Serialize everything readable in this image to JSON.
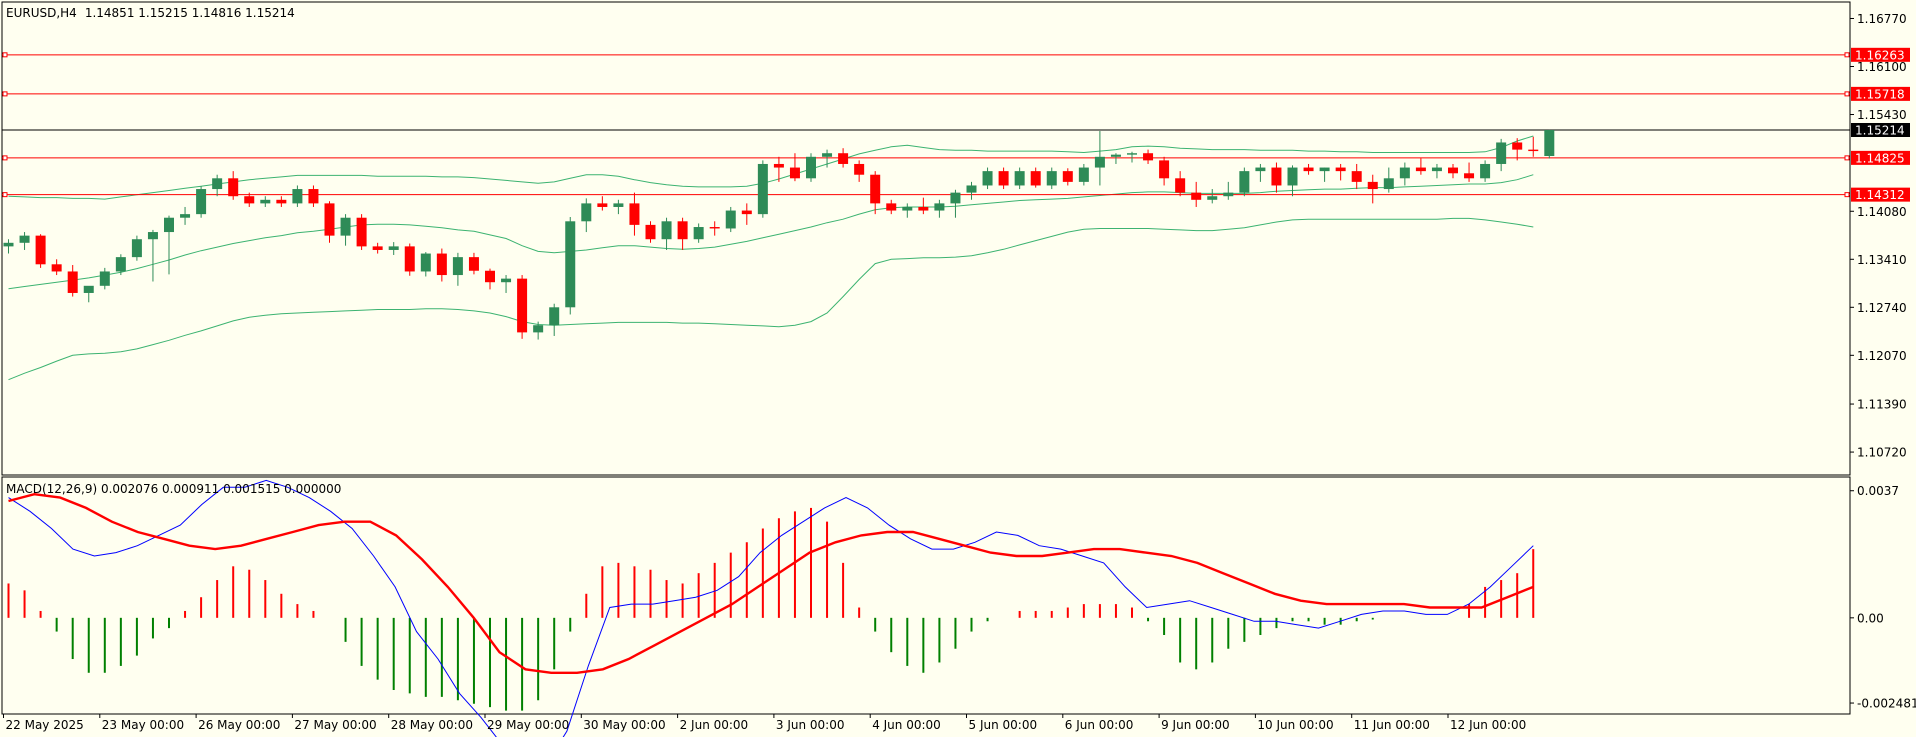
{
  "header": {
    "symbol": "EURUSD,H4",
    "ohlc": "1.14851 1.15215 1.14816 1.15214"
  },
  "macd_header": "MACD(12,26,9) 0.002076 0.000911 0.001515 0.000000",
  "colors": {
    "background": "#fffff0",
    "bull_candle": "#2e8b57",
    "bear_candle": "#ff0000",
    "bollinger": "#3cb371",
    "level_line": "#ff0000",
    "current_price": "#000000",
    "macd_line": "#0000ff",
    "signal_line": "#ff0000",
    "hist_positive": "#ff0000",
    "hist_negative": "#008000"
  },
  "chart_data": [
    {
      "type": "candlestick",
      "timeframe": "H4",
      "symbol": "EURUSD",
      "ylim": [
        1.104,
        1.17
      ],
      "yticks": [
        "1.16770",
        "1.16100",
        "1.15430",
        "1.14080",
        "1.13410",
        "1.12740",
        "1.12070",
        "1.11390",
        "1.10720"
      ],
      "xticks": [
        "22 May 2025",
        "23 May 00:00",
        "26 May 00:00",
        "27 May 00:00",
        "28 May 00:00",
        "29 May 00:00",
        "30 May 00:00",
        "2 Jun 00:00",
        "3 Jun 00:00",
        "4 Jun 00:00",
        "5 Jun 00:00",
        "6 Jun 00:00",
        "9 Jun 00:00",
        "10 Jun 00:00",
        "11 Jun 00:00",
        "12 Jun 00:00"
      ],
      "candles_per_day": 6,
      "candles": [
        [
          1.1359,
          1.1369,
          1.1349,
          1.1364
        ],
        [
          1.1364,
          1.1379,
          1.1354,
          1.1374
        ],
        [
          1.1374,
          1.1376,
          1.1329,
          1.1334
        ],
        [
          1.1334,
          1.1341,
          1.1319,
          1.1324
        ],
        [
          1.1324,
          1.1333,
          1.1289,
          1.1294
        ],
        [
          1.1294,
          1.1297,
          1.1281,
          1.1304
        ],
        [
          1.1304,
          1.1329,
          1.1299,
          1.1324
        ],
        [
          1.1324,
          1.1348,
          1.1319,
          1.1344
        ],
        [
          1.1344,
          1.1374,
          1.1339,
          1.1369
        ],
        [
          1.1369,
          1.1382,
          1.131,
          1.1379
        ],
        [
          1.1379,
          1.1402,
          1.132,
          1.1399
        ],
        [
          1.1399,
          1.1414,
          1.1389,
          1.1404
        ],
        [
          1.1404,
          1.1443,
          1.1399,
          1.1439
        ],
        [
          1.1439,
          1.1459,
          1.1429,
          1.1454
        ],
        [
          1.1454,
          1.1464,
          1.1424,
          1.1429
        ],
        [
          1.1429,
          1.1434,
          1.1414,
          1.1419
        ],
        [
          1.1419,
          1.1429,
          1.1414,
          1.1424
        ],
        [
          1.1424,
          1.1429,
          1.1414,
          1.1419
        ],
        [
          1.1419,
          1.1444,
          1.1414,
          1.1439
        ],
        [
          1.1439,
          1.1444,
          1.1414,
          1.1419
        ],
        [
          1.1419,
          1.1422,
          1.1364,
          1.1374
        ],
        [
          1.1374,
          1.1404,
          1.136,
          1.1399
        ],
        [
          1.1399,
          1.1404,
          1.1354,
          1.1359
        ],
        [
          1.1359,
          1.1364,
          1.1349,
          1.1354
        ],
        [
          1.1354,
          1.1365,
          1.1347,
          1.1359
        ],
        [
          1.1359,
          1.1363,
          1.1318,
          1.1324
        ],
        [
          1.1324,
          1.1351,
          1.1317,
          1.1349
        ],
        [
          1.1349,
          1.1356,
          1.131,
          1.1319
        ],
        [
          1.1319,
          1.135,
          1.1304,
          1.1344
        ],
        [
          1.1344,
          1.135,
          1.132,
          1.1325
        ],
        [
          1.1325,
          1.1328,
          1.1299,
          1.1309
        ],
        [
          1.1309,
          1.1319,
          1.1294,
          1.1314
        ],
        [
          1.1314,
          1.1319,
          1.123,
          1.1239
        ],
        [
          1.1239,
          1.1254,
          1.1229,
          1.1249
        ],
        [
          1.1249,
          1.1279,
          1.1234,
          1.1274
        ],
        [
          1.1274,
          1.14,
          1.1264,
          1.1394
        ],
        [
          1.1394,
          1.1426,
          1.1379,
          1.1419
        ],
        [
          1.1419,
          1.1429,
          1.1409,
          1.1414
        ],
        [
          1.1414,
          1.1424,
          1.1404,
          1.1419
        ],
        [
          1.1419,
          1.1434,
          1.1374,
          1.1389
        ],
        [
          1.1389,
          1.1394,
          1.1364,
          1.1369
        ],
        [
          1.1369,
          1.1399,
          1.1354,
          1.1394
        ],
        [
          1.1394,
          1.1399,
          1.1354,
          1.1369
        ],
        [
          1.1369,
          1.1391,
          1.1364,
          1.1386
        ],
        [
          1.1386,
          1.1394,
          1.1374,
          1.1384
        ],
        [
          1.1384,
          1.1414,
          1.1379,
          1.1409
        ],
        [
          1.1409,
          1.1419,
          1.1389,
          1.1404
        ],
        [
          1.1404,
          1.1479,
          1.1399,
          1.1474
        ],
        [
          1.1474,
          1.1484,
          1.1449,
          1.1469
        ],
        [
          1.1469,
          1.1489,
          1.145,
          1.1454
        ],
        [
          1.1454,
          1.1489,
          1.1449,
          1.1484
        ],
        [
          1.1484,
          1.1494,
          1.1469,
          1.1489
        ],
        [
          1.1489,
          1.1496,
          1.1469,
          1.1474
        ],
        [
          1.1474,
          1.1479,
          1.1449,
          1.1459
        ],
        [
          1.1459,
          1.1464,
          1.1404,
          1.1419
        ],
        [
          1.1419,
          1.1424,
          1.1404,
          1.1409
        ],
        [
          1.1409,
          1.1419,
          1.1399,
          1.1414
        ],
        [
          1.1414,
          1.1427,
          1.1404,
          1.1409
        ],
        [
          1.1409,
          1.1424,
          1.1399,
          1.1419
        ],
        [
          1.1419,
          1.1438,
          1.1399,
          1.1434
        ],
        [
          1.1434,
          1.1449,
          1.1424,
          1.1444
        ],
        [
          1.1444,
          1.1469,
          1.1439,
          1.1464
        ],
        [
          1.1464,
          1.1469,
          1.1439,
          1.1444
        ],
        [
          1.1444,
          1.1469,
          1.1439,
          1.1464
        ],
        [
          1.1464,
          1.1469,
          1.1441,
          1.1444
        ],
        [
          1.1444,
          1.1469,
          1.1439,
          1.1464
        ],
        [
          1.1464,
          1.1468,
          1.1444,
          1.1449
        ],
        [
          1.1449,
          1.1474,
          1.1444,
          1.1469
        ],
        [
          1.1469,
          1.152,
          1.1444,
          1.1484
        ],
        [
          1.1484,
          1.1489,
          1.1474,
          1.1487
        ],
        [
          1.1487,
          1.1491,
          1.1476,
          1.1489
        ],
        [
          1.1489,
          1.1494,
          1.1474,
          1.1479
        ],
        [
          1.1479,
          1.1484,
          1.1444,
          1.1454
        ],
        [
          1.1454,
          1.1464,
          1.1429,
          1.1434
        ],
        [
          1.1434,
          1.1449,
          1.1414,
          1.1424
        ],
        [
          1.1424,
          1.1439,
          1.1419,
          1.1429
        ],
        [
          1.1429,
          1.1449,
          1.1424,
          1.1434
        ],
        [
          1.1434,
          1.1469,
          1.1429,
          1.1464
        ],
        [
          1.1464,
          1.1474,
          1.1449,
          1.1469
        ],
        [
          1.1469,
          1.1476,
          1.1434,
          1.1444
        ],
        [
          1.1444,
          1.1472,
          1.1429,
          1.1469
        ],
        [
          1.1469,
          1.1474,
          1.1459,
          1.1464
        ],
        [
          1.1464,
          1.1469,
          1.1449,
          1.1469
        ],
        [
          1.1469,
          1.1474,
          1.1451,
          1.1464
        ],
        [
          1.1464,
          1.1474,
          1.1439,
          1.1449
        ],
        [
          1.1449,
          1.1459,
          1.1419,
          1.1439
        ],
        [
          1.1439,
          1.1469,
          1.1434,
          1.1454
        ],
        [
          1.1454,
          1.1476,
          1.1444,
          1.1469
        ],
        [
          1.1469,
          1.1482,
          1.1459,
          1.1464
        ],
        [
          1.1464,
          1.1474,
          1.1454,
          1.1469
        ],
        [
          1.1469,
          1.1474,
          1.1454,
          1.1461
        ],
        [
          1.1461,
          1.1476,
          1.1449,
          1.1454
        ],
        [
          1.1454,
          1.1479,
          1.1449,
          1.1474
        ],
        [
          1.1474,
          1.1509,
          1.1464,
          1.1504
        ],
        [
          1.1504,
          1.151,
          1.1479,
          1.1494
        ],
        [
          1.1494,
          1.1512,
          1.1484,
          1.1492
        ],
        [
          1.14851,
          1.15215,
          1.14816,
          1.15214
        ]
      ],
      "bollinger_upper": [
        1.1429,
        1.1428,
        1.1427,
        1.1427,
        1.1426,
        1.1426,
        1.1425,
        1.1428,
        1.1431,
        1.1434,
        1.1437,
        1.144,
        1.1443,
        1.1446,
        1.1449,
        1.1452,
        1.1454,
        1.1456,
        1.1458,
        1.1458,
        1.1458,
        1.1458,
        1.1458,
        1.1457,
        1.1457,
        1.1457,
        1.1457,
        1.1456,
        1.1456,
        1.1455,
        1.1453,
        1.1451,
        1.1449,
        1.1447,
        1.1449,
        1.1454,
        1.1459,
        1.1459,
        1.1457,
        1.1452,
        1.1448,
        1.1445,
        1.1443,
        1.1442,
        1.1442,
        1.1442,
        1.1443,
        1.1447,
        1.1453,
        1.146,
        1.1467,
        1.1474,
        1.1481,
        1.1488,
        1.1493,
        1.1498,
        1.15,
        1.1497,
        1.1494,
        1.1493,
        1.1493,
        1.1492,
        1.1492,
        1.1492,
        1.1492,
        1.1492,
        1.1491,
        1.149,
        1.1492,
        1.1494,
        1.1498,
        1.1499,
        1.1498,
        1.1496,
        1.1495,
        1.1494,
        1.1494,
        1.1494,
        1.1493,
        1.1493,
        1.1493,
        1.1492,
        1.1492,
        1.1491,
        1.1491,
        1.149,
        1.149,
        1.149,
        1.149,
        1.149,
        1.149,
        1.149,
        1.1491,
        1.1497,
        1.1506,
        1.1513
      ],
      "bollinger_middle": [
        1.13,
        1.1303,
        1.1306,
        1.1309,
        1.1312,
        1.1315,
        1.1319,
        1.1323,
        1.1328,
        1.1334,
        1.134,
        1.1347,
        1.1353,
        1.1358,
        1.1363,
        1.1367,
        1.1371,
        1.1374,
        1.1378,
        1.138,
        1.1383,
        1.1386,
        1.1389,
        1.139,
        1.139,
        1.1389,
        1.1387,
        1.1385,
        1.1382,
        1.138,
        1.1375,
        1.137,
        1.136,
        1.1352,
        1.135,
        1.1352,
        1.1354,
        1.1357,
        1.136,
        1.136,
        1.1358,
        1.1356,
        1.1355,
        1.1356,
        1.1358,
        1.1362,
        1.1366,
        1.1371,
        1.1376,
        1.1381,
        1.1386,
        1.1392,
        1.1397,
        1.1404,
        1.141,
        1.1413,
        1.1414,
        1.1414,
        1.1414,
        1.1415,
        1.1417,
        1.1419,
        1.1421,
        1.1423,
        1.1424,
        1.1425,
        1.1426,
        1.1428,
        1.143,
        1.1432,
        1.1434,
        1.1435,
        1.1435,
        1.1434,
        1.1433,
        1.1433,
        1.1433,
        1.1433,
        1.1434,
        1.1436,
        1.1437,
        1.1438,
        1.1439,
        1.1439,
        1.144,
        1.1441,
        1.1441,
        1.1442,
        1.1443,
        1.1444,
        1.1445,
        1.1446,
        1.1446,
        1.1448,
        1.1452,
        1.1459
      ],
      "bollinger_lower": [
        1.1173,
        1.1182,
        1.119,
        1.1199,
        1.1207,
        1.1209,
        1.121,
        1.1212,
        1.1216,
        1.1222,
        1.1228,
        1.1235,
        1.1241,
        1.1248,
        1.1255,
        1.126,
        1.1263,
        1.1265,
        1.1266,
        1.1267,
        1.1268,
        1.1269,
        1.127,
        1.1271,
        1.1271,
        1.1271,
        1.1272,
        1.1272,
        1.1271,
        1.1269,
        1.1266,
        1.1261,
        1.1254,
        1.125,
        1.1249,
        1.125,
        1.1251,
        1.1252,
        1.1253,
        1.1253,
        1.1253,
        1.1253,
        1.1252,
        1.1252,
        1.1251,
        1.125,
        1.1249,
        1.1248,
        1.1247,
        1.1249,
        1.1254,
        1.1266,
        1.1289,
        1.1313,
        1.1335,
        1.1341,
        1.1342,
        1.1343,
        1.1343,
        1.1344,
        1.1346,
        1.135,
        1.1355,
        1.1361,
        1.1367,
        1.1373,
        1.1379,
        1.1383,
        1.1384,
        1.1384,
        1.1384,
        1.1384,
        1.1383,
        1.1382,
        1.1381,
        1.1381,
        1.1383,
        1.1385,
        1.1389,
        1.1393,
        1.1396,
        1.1397,
        1.1397,
        1.1397,
        1.1397,
        1.1397,
        1.1397,
        1.1397,
        1.1397,
        1.1397,
        1.1398,
        1.1398,
        1.1396,
        1.1393,
        1.139,
        1.1386
      ],
      "price_levels": [
        {
          "label": "1.16263",
          "value": 1.16263
        },
        {
          "label": "1.15718",
          "value": 1.15718
        },
        {
          "label": "1.14825",
          "value": 1.14825
        },
        {
          "label": "1.14312",
          "value": 1.14312
        }
      ],
      "current_price": {
        "label": "1.15214",
        "value": 1.15214
      }
    },
    {
      "type": "macd",
      "params": "12,26,9",
      "ylim": [
        -0.0028,
        0.0041
      ],
      "yticks": [
        {
          "label": "0.0037",
          "value": 0.0037
        },
        {
          "label": "0.00",
          "value": 0
        },
        {
          "label": "-0.002481",
          "value": -0.002481
        }
      ],
      "histogram": [
        0.001,
        0.0008,
        0.0002,
        -0.0004,
        -0.0012,
        -0.0016,
        -0.0016,
        -0.0014,
        -0.0011,
        -0.0006,
        -0.0003,
        0.0002,
        0.0006,
        0.0011,
        0.0015,
        0.0014,
        0.0011,
        0.0007,
        0.0004,
        0.0002,
        0,
        -0.0007,
        -0.0014,
        -0.0018,
        -0.0021,
        -0.0022,
        -0.0023,
        -0.0023,
        -0.0024,
        -0.0025,
        -0.0026,
        -0.0027,
        -0.0027,
        -0.0024,
        -0.0015,
        -0.0004,
        0.0007,
        0.0015,
        0.0016,
        0.0015,
        0.0014,
        0.0011,
        0.001,
        0.0013,
        0.0016,
        0.0019,
        0.0022,
        0.0026,
        0.0029,
        0.0031,
        0.0032,
        0.0028,
        0.0016,
        0.0003,
        -0.0004,
        -0.001,
        -0.0014,
        -0.0016,
        -0.0013,
        -0.0009,
        -0.0004,
        -0.0001,
        0,
        0.0002,
        0.0002,
        0.0002,
        0.0003,
        0.0004,
        0.0004,
        0.0004,
        0.0003,
        -0.0001,
        -0.0005,
        -0.0013,
        -0.0015,
        -0.0013,
        -0.0009,
        -0.0007,
        -0.0005,
        -0.0003,
        -0.0001,
        -0.0001,
        -0.0002,
        -0.0002,
        -0.0001,
        -5e-05,
        0,
        0,
        0,
        0,
        0,
        0.0004,
        0.0009,
        0.0011,
        0.0013,
        0.002
      ],
      "macd": [
        0.0035,
        0.0031,
        0.0026,
        0.002,
        0.0018,
        0.0019,
        0.0021,
        0.0024,
        0.0027,
        0.0033,
        0.0038,
        0.0038,
        0.004,
        0.0038,
        0.0035,
        0.0031,
        0.0026,
        0.0018,
        0.0009,
        -0.0004,
        -0.0012,
        -0.0022,
        -0.0029,
        -0.0037,
        -0.0042,
        -0.0043,
        -0.0033,
        -0.0014,
        0.0003,
        0.0004,
        0.0004,
        0.0005,
        0.0006,
        0.0008,
        0.0012,
        0.0019,
        0.0024,
        0.0028,
        0.0032,
        0.0035,
        0.0032,
        0.0027,
        0.0023,
        0.002,
        0.002,
        0.0022,
        0.0025,
        0.0024,
        0.0021,
        0.002,
        0.0018,
        0.0016,
        0.0009,
        0.0003,
        0.0004,
        0.0005,
        0.0003,
        0.0001,
        -0.0001,
        -0.0001,
        -0.0002,
        -0.0003,
        -0.0001,
        0.0001,
        0.0002,
        0.0002,
        0.0001,
        0.0001,
        0.0004,
        0.0009,
        0.0015,
        0.0021
      ],
      "signal": [
        0.0034,
        0.0036,
        0.0035,
        0.0032,
        0.0028,
        0.0025,
        0.0023,
        0.0021,
        0.002,
        0.0021,
        0.0023,
        0.0025,
        0.0027,
        0.0028,
        0.0028,
        0.0024,
        0.0017,
        0.0009,
        0,
        -0.001,
        -0.0015,
        -0.0016,
        -0.0016,
        -0.0015,
        -0.0012,
        -0.0008,
        -0.0004,
        0,
        0.0004,
        0.0009,
        0.0014,
        0.0019,
        0.0022,
        0.0024,
        0.0025,
        0.0025,
        0.0023,
        0.0021,
        0.0019,
        0.0018,
        0.0018,
        0.0019,
        0.002,
        0.002,
        0.0019,
        0.0018,
        0.0016,
        0.0013,
        0.001,
        0.0007,
        0.0005,
        0.0004,
        0.0004,
        0.0004,
        0.0004,
        0.0003,
        0.0003,
        0.0003,
        0.0006,
        0.0009
      ]
    }
  ]
}
